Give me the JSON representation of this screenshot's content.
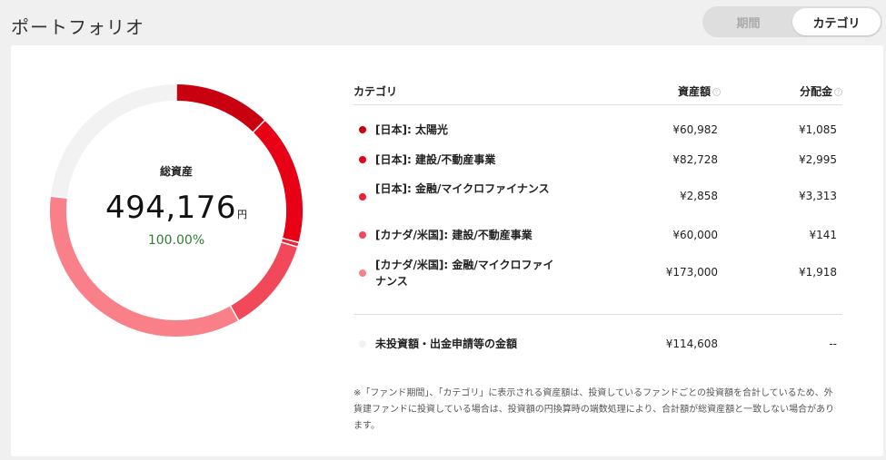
{
  "header": {
    "title": "ポートフォリオ",
    "toggle": {
      "period_label": "期間",
      "category_label": "カテゴリ",
      "selected": "category"
    }
  },
  "summary": {
    "label": "総資産",
    "value": "494,176",
    "unit": "円",
    "percent": "100.00%"
  },
  "table": {
    "headers": {
      "category": "カテゴリ",
      "asset": "資産額",
      "dividend": "分配金"
    },
    "rows": [
      {
        "label": "[日本]: 太陽光",
        "asset": "¥60,982",
        "dividend": "¥1,085",
        "color": "#c8000f",
        "amount": 60982
      },
      {
        "label": "[日本]: 建設/不動産事業",
        "asset": "¥82,728",
        "dividend": "¥2,995",
        "color": "#e80016",
        "amount": 82728
      },
      {
        "label": "[日本]: 金融/マイクロファイナンス",
        "asset": "¥2,858",
        "dividend": "¥3,313",
        "color": "#ef2035",
        "amount": 2858
      },
      {
        "label": "[カナダ/米国]: 建設/不動産事業",
        "asset": "¥60,000",
        "dividend": "¥141",
        "color": "#f2495a",
        "amount": 60000
      },
      {
        "label": "[カナダ/米国]: 金融/マイクロファイナンス",
        "asset": "¥173,000",
        "dividend": "¥1,918",
        "color": "#f98088",
        "amount": 173000
      }
    ],
    "uninvested": {
      "label": "未投資額・出金申請等の金額",
      "asset": "¥114,608",
      "dividend": "--",
      "color": "#f2f2f2",
      "amount": 114608
    }
  },
  "note": "※「ファンド期間」、「カテゴリ」に表示される資産額は、投資しているファンドごとの投資額を合計しているため、外貨建ファンドに投資している場合は、投資額の円換算時の端数処理により、合計額が総資産額と一致しない場合があります。"
}
